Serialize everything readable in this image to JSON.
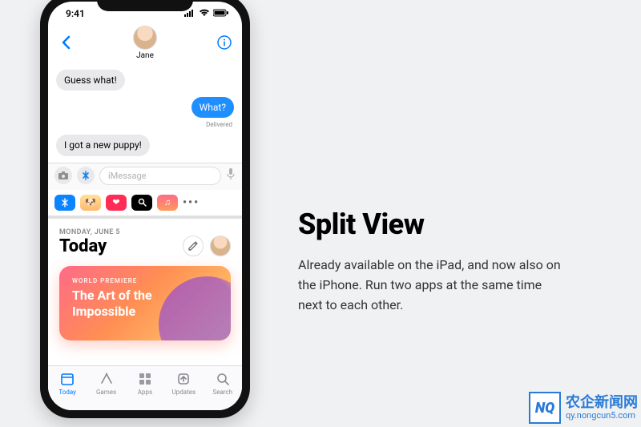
{
  "phone": {
    "status": {
      "time": "9:41"
    },
    "messages": {
      "contact_name": "Jane",
      "bubbles": {
        "b1": "Guess what!",
        "b2": "What?",
        "b3": "I got a new puppy!"
      },
      "delivered_label": "Delivered",
      "input_placeholder": "iMessage"
    },
    "appstore": {
      "date_label": "MONDAY, JUNE 5",
      "section_title": "Today",
      "card": {
        "eyebrow": "WORLD PREMIERE",
        "title": "The Art of the Impossible"
      },
      "tabs": {
        "today": "Today",
        "games": "Games",
        "apps": "Apps",
        "updates": "Updates",
        "search": "Search"
      }
    }
  },
  "copy": {
    "headline": "Split View",
    "body": "Already available on the iPad, and now also on the iPhone. Run two apps at the same time next to each other."
  },
  "watermark": {
    "brand": "农企新闻网",
    "url": "qy.nongcun5.com",
    "logo_text": "NQ"
  }
}
